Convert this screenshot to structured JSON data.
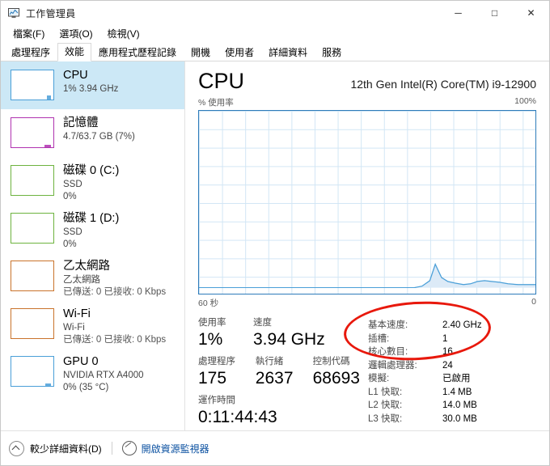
{
  "window": {
    "title": "工作管理員",
    "icon": "task-manager-icon",
    "minimize": "─",
    "maximize": "□",
    "close": "✕"
  },
  "menu": [
    {
      "label": "檔案(F)"
    },
    {
      "label": "選項(O)"
    },
    {
      "label": "檢視(V)"
    }
  ],
  "tabs": [
    {
      "label": "處理程序",
      "active": false
    },
    {
      "label": "效能",
      "active": true
    },
    {
      "label": "應用程式歷程記錄",
      "active": false
    },
    {
      "label": "開機",
      "active": false
    },
    {
      "label": "使用者",
      "active": false
    },
    {
      "label": "詳細資料",
      "active": false
    },
    {
      "label": "服務",
      "active": false
    }
  ],
  "sidebar": {
    "items": [
      {
        "name": "CPU",
        "title": "CPU",
        "line1": "1%  3.94 GHz",
        "line2": "",
        "color": "#4a9fd8",
        "selected": true
      },
      {
        "name": "memory",
        "title": "記憶體",
        "line1": "4.7/63.7 GB (7%)",
        "line2": "",
        "color": "#b033b0",
        "selected": false
      },
      {
        "name": "disk-0",
        "title": "磁碟 0 (C:)",
        "line1": "SSD",
        "line2": "0%",
        "color": "#6db33f",
        "selected": false
      },
      {
        "name": "disk-1",
        "title": "磁碟 1 (D:)",
        "line1": "SSD",
        "line2": "0%",
        "color": "#6db33f",
        "selected": false
      },
      {
        "name": "ethernet",
        "title": "乙太網路",
        "line1": "乙太網路",
        "line2": "已傳送: 0 已接收: 0 Kbps",
        "color": "#c9732b",
        "selected": false
      },
      {
        "name": "wifi",
        "title": "Wi-Fi",
        "line1": "Wi-Fi",
        "line2": "已傳送: 0 已接收: 0 Kbps",
        "color": "#c9732b",
        "selected": false
      },
      {
        "name": "gpu-0",
        "title": "GPU 0",
        "line1": "NVIDIA RTX A4000",
        "line2": "0%  (35 °C)",
        "color": "#4a9fd8",
        "selected": false
      }
    ]
  },
  "main": {
    "title": "CPU",
    "model": "12th Gen Intel(R) Core(TM) i9-12900",
    "y_axis_label": "% 使用率",
    "y_axis_max": "100%",
    "x_axis_left": "60 秒",
    "x_axis_right": "0",
    "stats_left": [
      {
        "label": "使用率",
        "value": "1%"
      },
      {
        "label": "速度",
        "value": "3.94 GHz"
      },
      {
        "label": "處理程序",
        "value": "175"
      },
      {
        "label": "執行緒",
        "value": "2637"
      },
      {
        "label": "控制代碼",
        "value": "68693"
      },
      {
        "label": "運作時間",
        "value": "0:11:44:43"
      }
    ],
    "specs": [
      {
        "key": "基本速度:",
        "value": "2.40 GHz"
      },
      {
        "key": "插槽:",
        "value": "1"
      },
      {
        "key": "核心數目:",
        "value": "16"
      },
      {
        "key": "邏輯處理器:",
        "value": "24"
      },
      {
        "key": "模擬:",
        "value": "已啟用"
      },
      {
        "key": "L1 快取:",
        "value": "1.4 MB"
      },
      {
        "key": "L2 快取:",
        "value": "14.0 MB"
      },
      {
        "key": "L3 快取:",
        "value": "30.0 MB"
      }
    ],
    "annotation": {
      "shape": "red-ellipse",
      "color": "#e8180c"
    }
  },
  "chart_data": {
    "type": "area",
    "title": "% 使用率",
    "xlabel": "60 秒",
    "ylabel": "% 使用率",
    "xlim": [
      60,
      0
    ],
    "ylim": [
      0,
      100
    ],
    "grid": true,
    "line_color": "#4a9fd8",
    "fill_color": "#dceaf7",
    "series": [
      {
        "name": "CPU 使用率",
        "x": [
          60,
          22,
          20,
          18,
          16.5,
          15.5,
          14.5,
          13,
          11.5,
          10.5,
          9,
          7.5,
          6,
          4.5,
          3,
          1.5,
          0
        ],
        "values": [
          0,
          0,
          1,
          4,
          13,
          6,
          4,
          3,
          2.5,
          2,
          3.5,
          4,
          3.8,
          3.2,
          2,
          1.5,
          1
        ]
      }
    ]
  },
  "footer": {
    "less_details": "較少詳細資料(D)",
    "resource_monitor": "開啟資源監視器"
  }
}
